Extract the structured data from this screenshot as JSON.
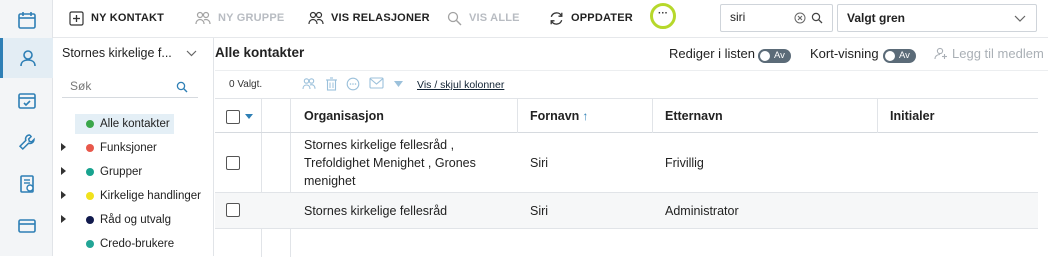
{
  "toolbar": {
    "new_contact": "NY KONTAKT",
    "new_group": "NY GRUPPE",
    "show_relations": "VIS RELASJONER",
    "show_all": "VIS ALLE",
    "update": "OPPDATER",
    "more": "···",
    "search_value": "siri",
    "branch_select": "Valgt gren"
  },
  "tree": {
    "header": "Stornes kirkelige f...",
    "search_placeholder": "Søk",
    "items": [
      {
        "label": "Alle kontakter",
        "color": "#3aa64a"
      },
      {
        "label": "Funksjoner",
        "color": "#e8584b"
      },
      {
        "label": "Grupper",
        "color": "#18a38f"
      },
      {
        "label": "Kirkelige handlinger",
        "color": "#f1e21c"
      },
      {
        "label": "Råd og utvalg",
        "color": "#111a4d"
      },
      {
        "label": "Credo-brukere",
        "color": "#22a596"
      }
    ]
  },
  "main": {
    "title": "Alle kontakter",
    "edit_in_list_label": "Rediger i listen",
    "edit_in_list_state": "Av",
    "card_view_label": "Kort-visning",
    "card_view_state": "Av",
    "add_member": "Legg til medlem",
    "selected_count": "0 Valgt.",
    "show_hide_columns": "Vis / skjul kolonner"
  },
  "table": {
    "columns": [
      "Organisasjon",
      "Fornavn",
      "Etternavn",
      "Initialer"
    ],
    "sort_indicator": "↑",
    "rows": [
      {
        "org": "Stornes kirkelige fellesråd , Trefoldighet Menighet , Grones menighet",
        "first": "Siri",
        "last": "Frivillig",
        "initials": ""
      },
      {
        "org": "Stornes kirkelige fellesråd",
        "first": "Siri",
        "last": "Administrator",
        "initials": ""
      }
    ]
  },
  "colors": {
    "accent": "#2e7fb5",
    "highlight_ring": "#b6d82b",
    "toggle_off": "#5b6b78"
  }
}
